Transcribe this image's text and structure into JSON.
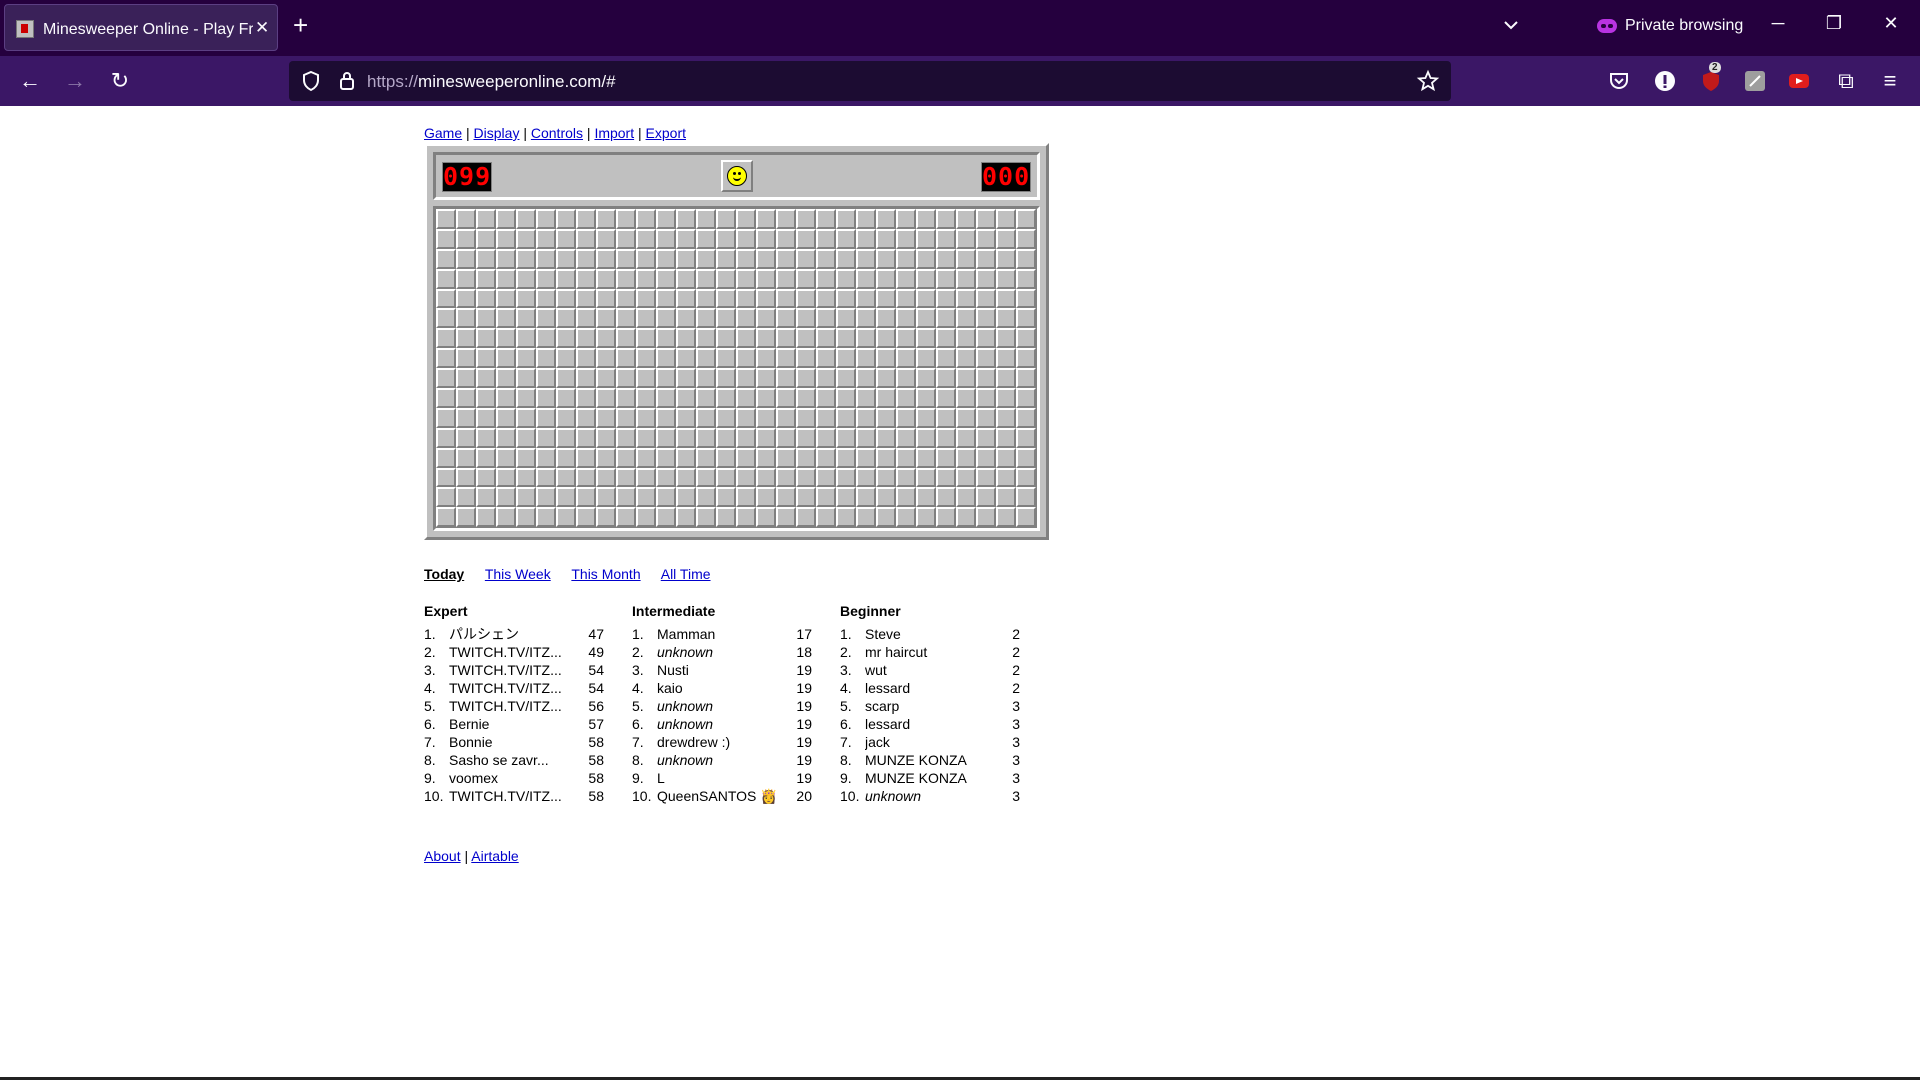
{
  "browser": {
    "tab_title": "Minesweeper Online - Play Free",
    "tab_close": "✕",
    "new_tab": "+",
    "private_label": "Private browsing",
    "url_proto": "https://",
    "url_rest": "minesweeperonline.com/#",
    "extension_badge": "2"
  },
  "menu": {
    "game": "Game",
    "display": "Display",
    "controls": "Controls",
    "import": "Import",
    "export": "Export",
    "separator": " | "
  },
  "game": {
    "mines_counter": "099",
    "timer_counter": "000",
    "rows": 16,
    "columns": 30,
    "face": "smiley"
  },
  "score_tabs": {
    "today": "Today",
    "this_week": "This Week",
    "this_month": "This Month",
    "all_time": "All Time",
    "active": "today"
  },
  "leaderboards": [
    {
      "title": "Expert",
      "rows": [
        {
          "rank": "1.",
          "name": "パルシェン",
          "score": "47"
        },
        {
          "rank": "2.",
          "name": "TWITCH.TV/ITZ...",
          "score": "49"
        },
        {
          "rank": "3.",
          "name": "TWITCH.TV/ITZ...",
          "score": "54"
        },
        {
          "rank": "4.",
          "name": "TWITCH.TV/ITZ...",
          "score": "54"
        },
        {
          "rank": "5.",
          "name": "TWITCH.TV/ITZ...",
          "score": "56"
        },
        {
          "rank": "6.",
          "name": "Bernie",
          "score": "57"
        },
        {
          "rank": "7.",
          "name": "Bonnie",
          "score": "58"
        },
        {
          "rank": "8.",
          "name": "Sasho se zavr...",
          "score": "58"
        },
        {
          "rank": "9.",
          "name": "voomex",
          "score": "58"
        },
        {
          "rank": "10.",
          "name": "TWITCH.TV/ITZ...",
          "score": "58"
        }
      ]
    },
    {
      "title": "Intermediate",
      "rows": [
        {
          "rank": "1.",
          "name": "Mamman",
          "score": "17"
        },
        {
          "rank": "2.",
          "name": "unknown",
          "score": "18",
          "unknown": true
        },
        {
          "rank": "3.",
          "name": "Nusti",
          "score": "19"
        },
        {
          "rank": "4.",
          "name": "kaio",
          "score": "19"
        },
        {
          "rank": "5.",
          "name": "unknown",
          "score": "19",
          "unknown": true
        },
        {
          "rank": "6.",
          "name": "unknown",
          "score": "19",
          "unknown": true
        },
        {
          "rank": "7.",
          "name": "drewdrew :)",
          "score": "19"
        },
        {
          "rank": "8.",
          "name": "unknown",
          "score": "19",
          "unknown": true
        },
        {
          "rank": "9.",
          "name": "L",
          "score": "19"
        },
        {
          "rank": "10.",
          "name": "QueenSANTOS 👸",
          "score": "20"
        }
      ]
    },
    {
      "title": "Beginner",
      "rows": [
        {
          "rank": "1.",
          "name": "Steve",
          "score": "2"
        },
        {
          "rank": "2.",
          "name": "mr haircut",
          "score": "2"
        },
        {
          "rank": "3.",
          "name": "wut",
          "score": "2"
        },
        {
          "rank": "4.",
          "name": "lessard",
          "score": "2"
        },
        {
          "rank": "5.",
          "name": "scarp",
          "score": "3"
        },
        {
          "rank": "6.",
          "name": "lessard",
          "score": "3"
        },
        {
          "rank": "7.",
          "name": "jack",
          "score": "3"
        },
        {
          "rank": "8.",
          "name": "MUNZE KONZA",
          "score": "3"
        },
        {
          "rank": "9.",
          "name": "MUNZE KONZA",
          "score": "3"
        },
        {
          "rank": "10.",
          "name": "unknown",
          "score": "3",
          "unknown": true
        }
      ]
    }
  ],
  "footer": {
    "about": "About",
    "airtable": "Airtable",
    "separator": " | "
  }
}
